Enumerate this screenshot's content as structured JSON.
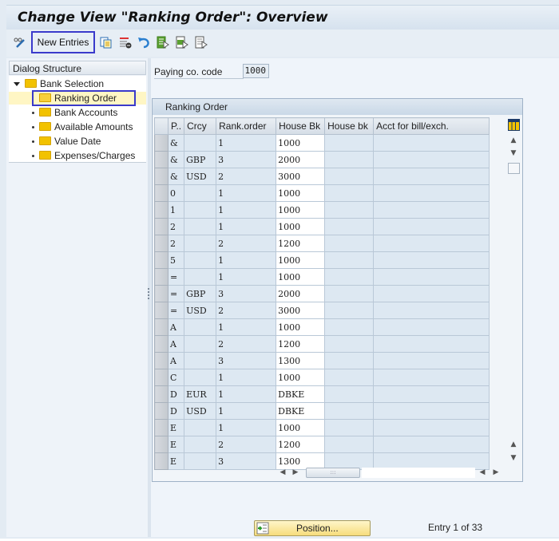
{
  "window": {
    "title": "Change View \"Ranking Order\": Overview"
  },
  "toolbar": {
    "new_entries_label": "New Entries",
    "icons": [
      "display-change-icon",
      "copy-icon",
      "delete-icon",
      "undo-icon",
      "select-all-icon",
      "select-block-icon",
      "deselect-all-icon"
    ]
  },
  "dialog_structure": {
    "header": "Dialog Structure",
    "items": [
      {
        "label": "Bank Selection",
        "level": 0,
        "expanded": true
      },
      {
        "label": "Ranking Order",
        "level": 1,
        "selected": true
      },
      {
        "label": "Bank Accounts",
        "level": 1
      },
      {
        "label": "Available Amounts",
        "level": 1
      },
      {
        "label": "Value Date",
        "level": 1
      },
      {
        "label": "Expenses/Charges",
        "level": 1
      }
    ]
  },
  "paying_co_code": {
    "label": "Paying co. code",
    "value": "1000"
  },
  "table": {
    "title": "Ranking Order",
    "columns": [
      "P..",
      "Crcy",
      "Rank.order",
      "House Bk",
      "House bk",
      "Acct for bill/exch."
    ],
    "rows": [
      [
        "&",
        "",
        "1",
        "1000",
        "",
        ""
      ],
      [
        "&",
        "GBP",
        "3",
        "2000",
        "",
        ""
      ],
      [
        "&",
        "USD",
        "2",
        "3000",
        "",
        ""
      ],
      [
        "0",
        "",
        "1",
        "1000",
        "",
        ""
      ],
      [
        "1",
        "",
        "1",
        "1000",
        "",
        ""
      ],
      [
        "2",
        "",
        "1",
        "1000",
        "",
        ""
      ],
      [
        "2",
        "",
        "2",
        "1200",
        "",
        ""
      ],
      [
        "5",
        "",
        "1",
        "1000",
        "",
        ""
      ],
      [
        "=",
        "",
        "1",
        "1000",
        "",
        ""
      ],
      [
        "=",
        "GBP",
        "3",
        "2000",
        "",
        ""
      ],
      [
        "=",
        "USD",
        "2",
        "3000",
        "",
        ""
      ],
      [
        "A",
        "",
        "1",
        "1000",
        "",
        ""
      ],
      [
        "A",
        "",
        "2",
        "1200",
        "",
        ""
      ],
      [
        "A",
        "",
        "3",
        "1300",
        "",
        ""
      ],
      [
        "C",
        "",
        "1",
        "1000",
        "",
        ""
      ],
      [
        "D",
        "EUR",
        "1",
        "DBKE",
        "",
        ""
      ],
      [
        "D",
        "USD",
        "1",
        "DBKE",
        "",
        ""
      ],
      [
        "E",
        "",
        "1",
        "1000",
        "",
        ""
      ],
      [
        "E",
        "",
        "2",
        "1200",
        "",
        ""
      ],
      [
        "E",
        "",
        "3",
        "1300",
        "",
        ""
      ]
    ]
  },
  "footer": {
    "position_label": "Position...",
    "entry_text": "Entry 1 of 33"
  },
  "colors": {
    "highlight_border": "#3a3acb",
    "position_button": "#f6dc7c",
    "selected_tree_bg": "#fff6c4"
  }
}
